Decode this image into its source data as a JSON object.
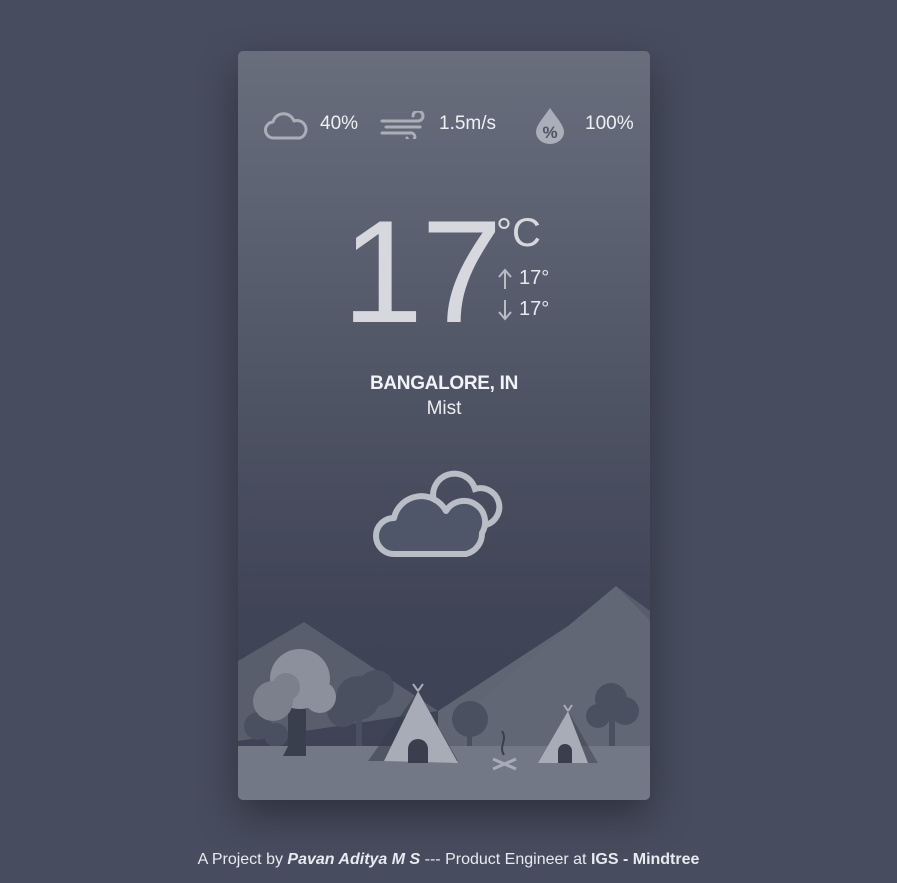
{
  "weather": {
    "cloudiness": "40%",
    "wind_speed": "1.5m/s",
    "humidity": "100%",
    "temperature": "17",
    "unit": "°C",
    "high": "17°",
    "low": "17°",
    "city": "BANGALORE, IN",
    "condition": "Mist",
    "icons": {
      "cloudiness": "cloud-icon",
      "wind": "wind-icon",
      "humidity": "humidity-drop-icon",
      "high": "arrow-up-icon",
      "low": "arrow-down-icon",
      "main": "clouds-icon"
    }
  },
  "footer": {
    "prefix": "A Project by ",
    "author": "Pavan Aditya M S",
    "middle": " --- Product Engineer at ",
    "company": "IGS - Mindtree"
  },
  "colors": {
    "page_background": "#474c5e",
    "card_top": "#686e7c",
    "card_bottom": "#3d4254",
    "text": "#eef0f4"
  }
}
